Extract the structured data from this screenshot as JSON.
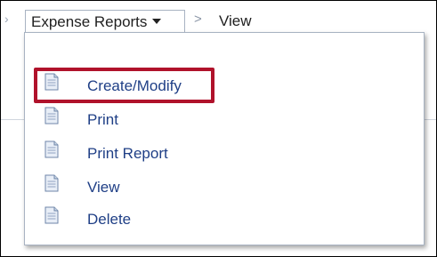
{
  "breadcrumb": {
    "menu_label": "Expense Reports",
    "separator": ">",
    "current": "View"
  },
  "menu": {
    "items": [
      {
        "label": "Create/Modify",
        "icon": "document-icon",
        "highlighted": true
      },
      {
        "label": "Print",
        "icon": "document-icon"
      },
      {
        "label": "Print Report",
        "icon": "document-icon"
      },
      {
        "label": "View",
        "icon": "document-icon"
      },
      {
        "label": "Delete",
        "icon": "document-icon"
      }
    ]
  },
  "colors": {
    "highlight": "#b0122b",
    "link_text": "#1f3f86"
  }
}
